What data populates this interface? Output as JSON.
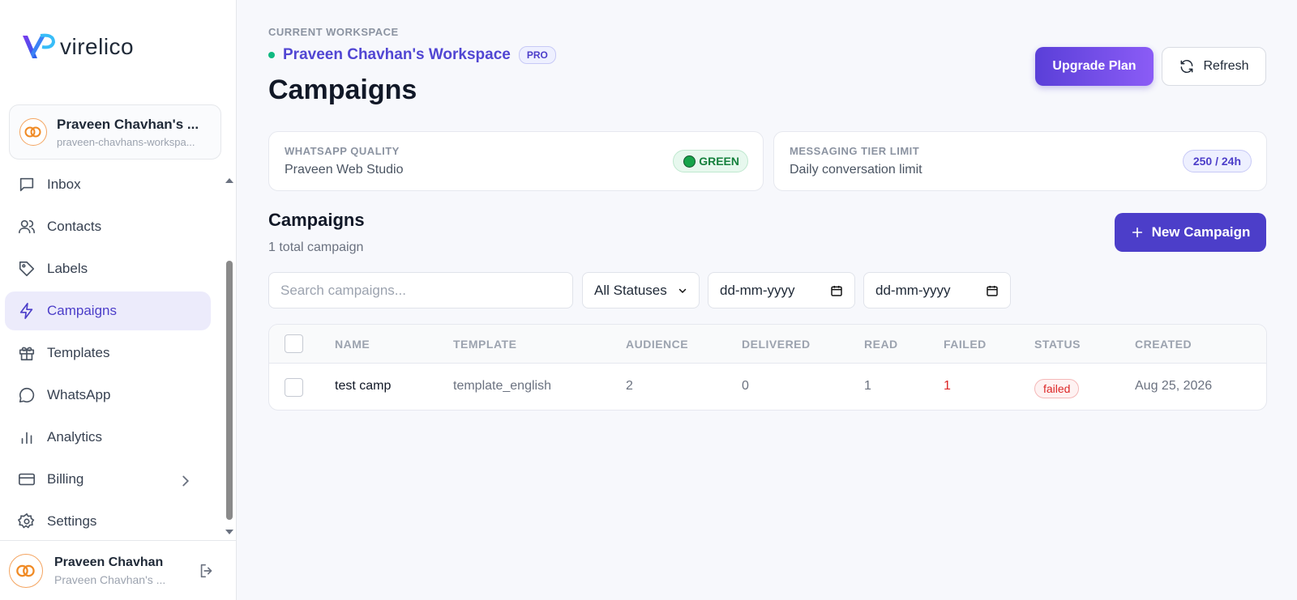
{
  "sidebar": {
    "logo_text": "virelico",
    "workspace": {
      "name": "Praveen Chavhan's ...",
      "slug": "praveen-chavhans-workspa..."
    },
    "nav": [
      {
        "label": "Inbox",
        "icon": "inbox-icon"
      },
      {
        "label": "Contacts",
        "icon": "contacts-icon"
      },
      {
        "label": "Labels",
        "icon": "label-icon"
      },
      {
        "label": "Campaigns",
        "icon": "bolt-icon",
        "active": true
      },
      {
        "label": "Templates",
        "icon": "gift-icon"
      },
      {
        "label": "WhatsApp",
        "icon": "chat-icon"
      },
      {
        "label": "Analytics",
        "icon": "bar-chart-icon"
      },
      {
        "label": "Billing",
        "icon": "credit-card-icon",
        "has_submenu": true
      },
      {
        "label": "Settings",
        "icon": "gear-icon"
      }
    ],
    "user": {
      "name": "Praveen Chavhan",
      "sub": "Praveen Chavhan's ..."
    }
  },
  "header": {
    "current_workspace_label": "CURRENT WORKSPACE",
    "workspace_name": "Praveen Chavhan's Workspace",
    "plan_badge": "PRO",
    "title": "Campaigns",
    "upgrade_label": "Upgrade Plan",
    "refresh_label": "Refresh"
  },
  "cards": {
    "quality": {
      "label": "WHATSAPP QUALITY",
      "value": "Praveen Web Studio",
      "badge": "GREEN"
    },
    "tier": {
      "label": "MESSAGING TIER LIMIT",
      "value": "Daily conversation limit",
      "badge": "250 / 24h"
    }
  },
  "campaigns": {
    "section_title": "Campaigns",
    "count_text": "1 total campaign",
    "new_label": "New Campaign",
    "search_placeholder": "Search campaigns...",
    "status_filter": "All Statuses",
    "date_from_placeholder": "dd-mm-yyyy",
    "date_to_placeholder": "dd-mm-yyyy",
    "columns": [
      "NAME",
      "TEMPLATE",
      "AUDIENCE",
      "DELIVERED",
      "READ",
      "FAILED",
      "STATUS",
      "CREATED"
    ],
    "rows": [
      {
        "name": "test camp",
        "template": "template_english",
        "audience": "2",
        "delivered": "0",
        "read": "1",
        "failed": "1",
        "status": "failed",
        "created": "Aug 25, 2026"
      }
    ]
  },
  "colors": {
    "accent": "#4c3ec9",
    "success": "#10b981",
    "danger": "#dc2626"
  }
}
